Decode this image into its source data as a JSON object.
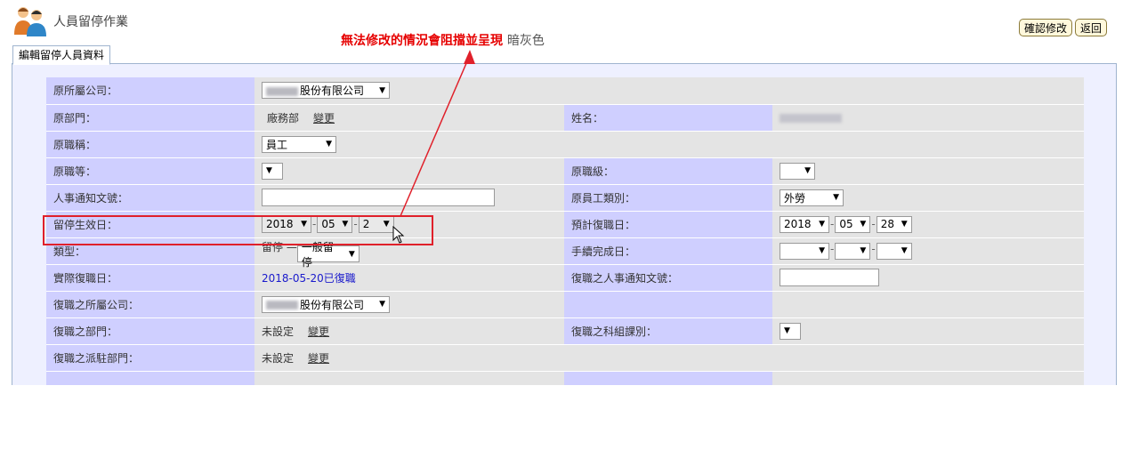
{
  "header": {
    "title": "人員留停作業",
    "buttons": {
      "confirm": "確認修改",
      "back": "返回"
    }
  },
  "annotation": {
    "main": "無法修改的情況會阻擋並呈現",
    "gray_part": "暗灰色",
    "color": "#e60000"
  },
  "tab": {
    "label": "編輯留停人員資料"
  },
  "form": {
    "original_company": {
      "label": "原所屬公司：",
      "value": "股份有限公司"
    },
    "original_dept": {
      "label": "原部門：",
      "value": "廠務部",
      "link": "變更"
    },
    "name": {
      "label": "姓名："
    },
    "original_title": {
      "label": "原職稱：",
      "value": "員工"
    },
    "original_grade": {
      "label": "原職等：",
      "value": ""
    },
    "original_level": {
      "label": "原職級：",
      "value": ""
    },
    "notice_no": {
      "label": "人事通知文號：",
      "value": ""
    },
    "employee_type": {
      "label": "原員工類別：",
      "value": "外勞"
    },
    "effective_date": {
      "label": "留停生效日：",
      "year": "2018",
      "month": "05",
      "day": "2"
    },
    "expected_return": {
      "label": "預計復職日：",
      "year": "2018",
      "month": "05",
      "day": "28"
    },
    "type": {
      "label": "類型：",
      "prefix": "留停 —",
      "value": "一般留停"
    },
    "procedure_done": {
      "label": "手續完成日："
    },
    "actual_return": {
      "label": "實際復職日：",
      "value": "2018-05-20已復職"
    },
    "return_notice": {
      "label": "復職之人事通知文號：",
      "value": ""
    },
    "return_company": {
      "label": "復職之所屬公司：",
      "value": "股份有限公司"
    },
    "return_dept": {
      "label": "復職之部門：",
      "value": "未設定",
      "link": "變更"
    },
    "return_section": {
      "label": "復職之科組課別：",
      "value": ""
    },
    "return_station": {
      "label": "復職之派駐部門：",
      "value": "未設定",
      "link": "變更"
    }
  }
}
